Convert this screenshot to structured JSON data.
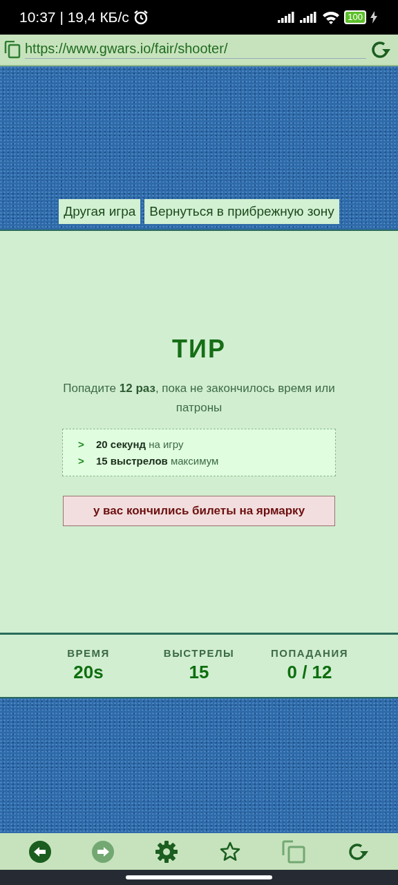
{
  "status_bar": {
    "time": "10:37 | 19,4 КБ/с",
    "battery": "100"
  },
  "address_bar": {
    "url": "https://www.gwars.io/fair/shooter/"
  },
  "nav_buttons": [
    {
      "label": "Другая игра"
    },
    {
      "label": "Вернуться в прибрежную зону"
    }
  ],
  "game": {
    "title": "ТИР",
    "description": "Попадите **12 раз**, пока не закончилось время или патроны",
    "rules": [
      {
        "marker": ">",
        "text": "**20 секунд** на игру"
      },
      {
        "marker": ">",
        "text": "**15 выстрелов** максимум"
      }
    ],
    "alert": "у вас кончились билеты на ярмарку"
  },
  "stats": [
    {
      "label": "ВРЕМЯ",
      "value": "20s"
    },
    {
      "label": "ВЫСТРЕЛЫ",
      "value": "15"
    },
    {
      "label": "ПОПАДАНИЯ",
      "value": "0 / 12"
    }
  ],
  "toolbar": [
    {
      "kind": "back",
      "disabled": false
    },
    {
      "kind": "forward",
      "disabled": true
    },
    {
      "kind": "settings",
      "disabled": false
    },
    {
      "kind": "bookmark",
      "disabled": false
    },
    {
      "kind": "tabs",
      "disabled": true
    },
    {
      "kind": "reload",
      "disabled": false
    }
  ]
}
